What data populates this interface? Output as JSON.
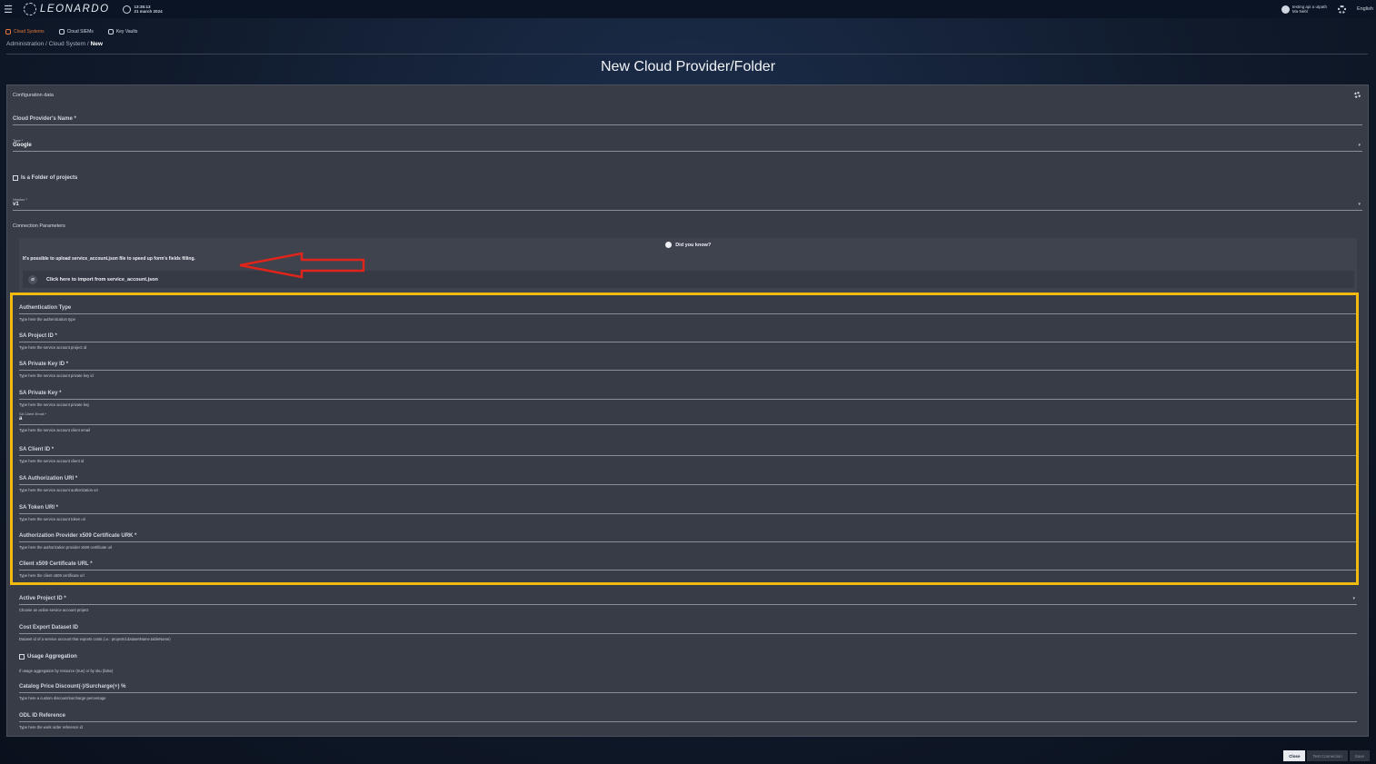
{
  "header": {
    "app_name": "LEONARDO",
    "time": "13:35:13",
    "date": "21 march 2024",
    "user_line1": "testing api a utpath",
    "user_line2": "Ma-Nebl",
    "language": "English"
  },
  "nav": {
    "tabs": [
      {
        "label": "Cloud Systems",
        "active": true
      },
      {
        "label": "Cloud SIEMs",
        "active": false
      },
      {
        "label": "Key Vaults",
        "active": false
      }
    ]
  },
  "breadcrumb": {
    "items": [
      "Administration",
      "Cloud System"
    ],
    "current": "New",
    "separator": "/"
  },
  "page_title": "New Cloud Provider/Folder",
  "config": {
    "section_title": "Configuration data",
    "provider_name_label": "Cloud Provider's Name *",
    "type_label": "Type *",
    "type_value": "Google",
    "folder_checkbox_label": "Is a Folder of projects",
    "version_label": "Version *",
    "version_value": "v1",
    "connection_title": "Connection Parameters"
  },
  "info": {
    "title": "Did you know?",
    "text": "It's possible to upload service_account.json file to speed up form's fields filling.",
    "import_label": "Click here to import from service_account.json"
  },
  "highlighted_fields": [
    {
      "label": "Authentication Type",
      "hint": "Type here the authentication type"
    },
    {
      "label": "SA Project ID *",
      "hint": "Type here the service account project id"
    },
    {
      "label": "SA Private Key ID *",
      "hint": "Type here the service account private key id"
    },
    {
      "label": "SA Private Key *",
      "hint": "Type here the service account private key"
    },
    {
      "label": "SA Client Email *",
      "value": "a",
      "hint": "Type here the service account client email"
    },
    {
      "label": "SA Client ID *",
      "hint": "Type here the service account client id"
    },
    {
      "label": "SA Authorization URI *",
      "hint": "Type here the service account authorization uri"
    },
    {
      "label": "SA Token URI *",
      "hint": "Type here the service account token uri"
    },
    {
      "label": "Authorization Provider x509 Certificate URK *",
      "hint": "Type here the authorization provider x509 certificate url"
    },
    {
      "label": "Client x509 Certificate URL *",
      "hint": "Type here the client x509 certificate url"
    }
  ],
  "other_fields": {
    "active_project": {
      "label": "Active Project ID *",
      "hint": "Choose an active service account project"
    },
    "cost_export": {
      "label": "Cost Export Dataset ID",
      "hint": "Dataset id of a service account that exports costs (i.e.: projectId.datasetName.tableName)"
    },
    "usage_aggregation": {
      "label": "Usage Aggregation",
      "hint": "If usage aggregation by resource (true) or by sku (false)"
    },
    "catalog_price": {
      "label": "Catalog Price Discount(-)/Surcharge(+) %",
      "hint": "Type here a custom discount/surcharge percentage"
    },
    "odl_id": {
      "label": "ODL ID Reference",
      "hint": "Type here the work order reference id"
    }
  },
  "footer": {
    "close": "Close",
    "test_connection": "Test Connection",
    "save": "Save"
  },
  "colors": {
    "highlight": "#f2b90f",
    "arrow": "#e0241b",
    "active_tab": "#e2783a"
  }
}
